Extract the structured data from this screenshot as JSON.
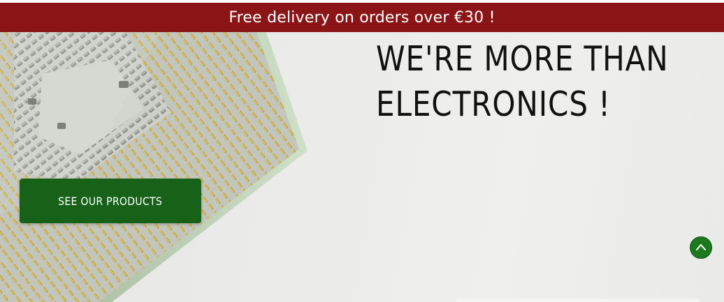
{
  "promo": {
    "text": "Free delivery on orders over €30 !"
  },
  "hero": {
    "headline_line1": "WE'RE MORE THAN",
    "headline_line2": "ELECTRONICS !",
    "cta_label": "SEE OUR PRODUCTS",
    "background_image": "cpu-chip-gold-pins"
  },
  "scroll_top": {
    "icon": "chevron-up-icon"
  },
  "colors": {
    "promo_bg": "#8b1416",
    "cta_bg": "#176119",
    "scroll_bg": "#1c7a1e",
    "headline": "#111111"
  }
}
